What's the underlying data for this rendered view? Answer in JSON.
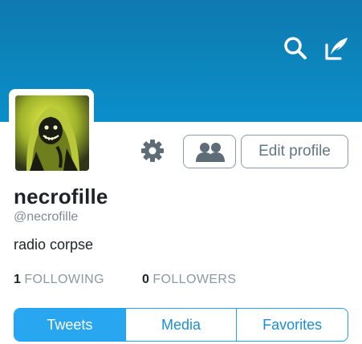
{
  "header": {
    "background_color": "#0c85bd",
    "search_icon": "search-icon",
    "compose_icon": "compose-tweet-icon"
  },
  "profile": {
    "avatar_icon": "avatar-image",
    "name": "necrofille",
    "handle": "@necrofille",
    "bio": "radio corpse"
  },
  "actions": {
    "settings_icon": "gear-icon",
    "follow_icon": "people-icon",
    "edit_label": "Edit profile"
  },
  "stats": {
    "following_count": "1",
    "following_label": "FOLLOWING",
    "followers_count": "0",
    "followers_label": "FOLLOWERS"
  },
  "tabs": [
    {
      "label": "Tweets",
      "active": true
    },
    {
      "label": "Media",
      "active": false
    },
    {
      "label": "Favorites",
      "active": false
    }
  ],
  "colors": {
    "accent": "#1da1f2",
    "text_primary": "#1f2327",
    "text_secondary": "#8c98a2"
  }
}
